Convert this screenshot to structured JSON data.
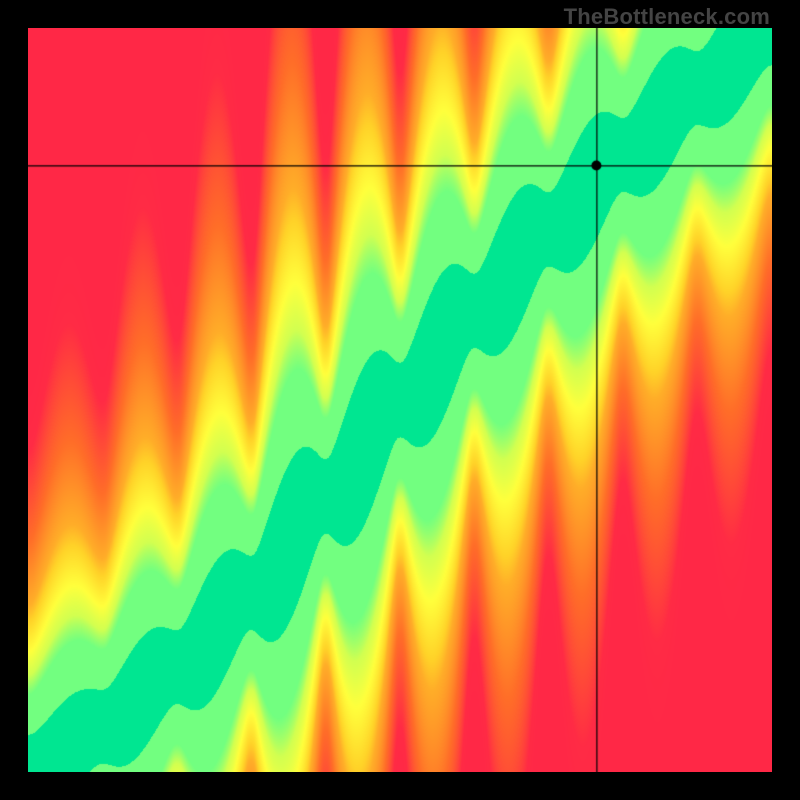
{
  "watermark": "TheBottleneck.com",
  "chart_data": {
    "type": "heatmap",
    "title": "",
    "xlabel": "",
    "ylabel": "",
    "xlim": [
      0,
      100
    ],
    "ylim": [
      0,
      100
    ],
    "plot_size": 744,
    "crosshair": {
      "x": 76.5,
      "y": 81.5
    },
    "marker": {
      "x": 76.5,
      "y": 81.5
    },
    "ideal_curve_points": [
      {
        "x": 0,
        "y": 0
      },
      {
        "x": 10,
        "y": 6
      },
      {
        "x": 20,
        "y": 14
      },
      {
        "x": 30,
        "y": 24
      },
      {
        "x": 40,
        "y": 37
      },
      {
        "x": 50,
        "y": 50
      },
      {
        "x": 60,
        "y": 62
      },
      {
        "x": 70,
        "y": 73
      },
      {
        "x": 80,
        "y": 83
      },
      {
        "x": 90,
        "y": 92
      },
      {
        "x": 100,
        "y": 100
      }
    ],
    "color_stops": [
      {
        "t": 0.0,
        "hex": "#ff2846"
      },
      {
        "t": 0.25,
        "hex": "#ff6e28"
      },
      {
        "t": 0.5,
        "hex": "#ffd228"
      },
      {
        "t": 0.68,
        "hex": "#ffff3c"
      },
      {
        "t": 0.8,
        "hex": "#d2ff50"
      },
      {
        "t": 0.9,
        "hex": "#5aff8c"
      },
      {
        "t": 1.0,
        "hex": "#00e691"
      }
    ],
    "band_half_width": 5.0,
    "falloff_scale": 42.0
  }
}
